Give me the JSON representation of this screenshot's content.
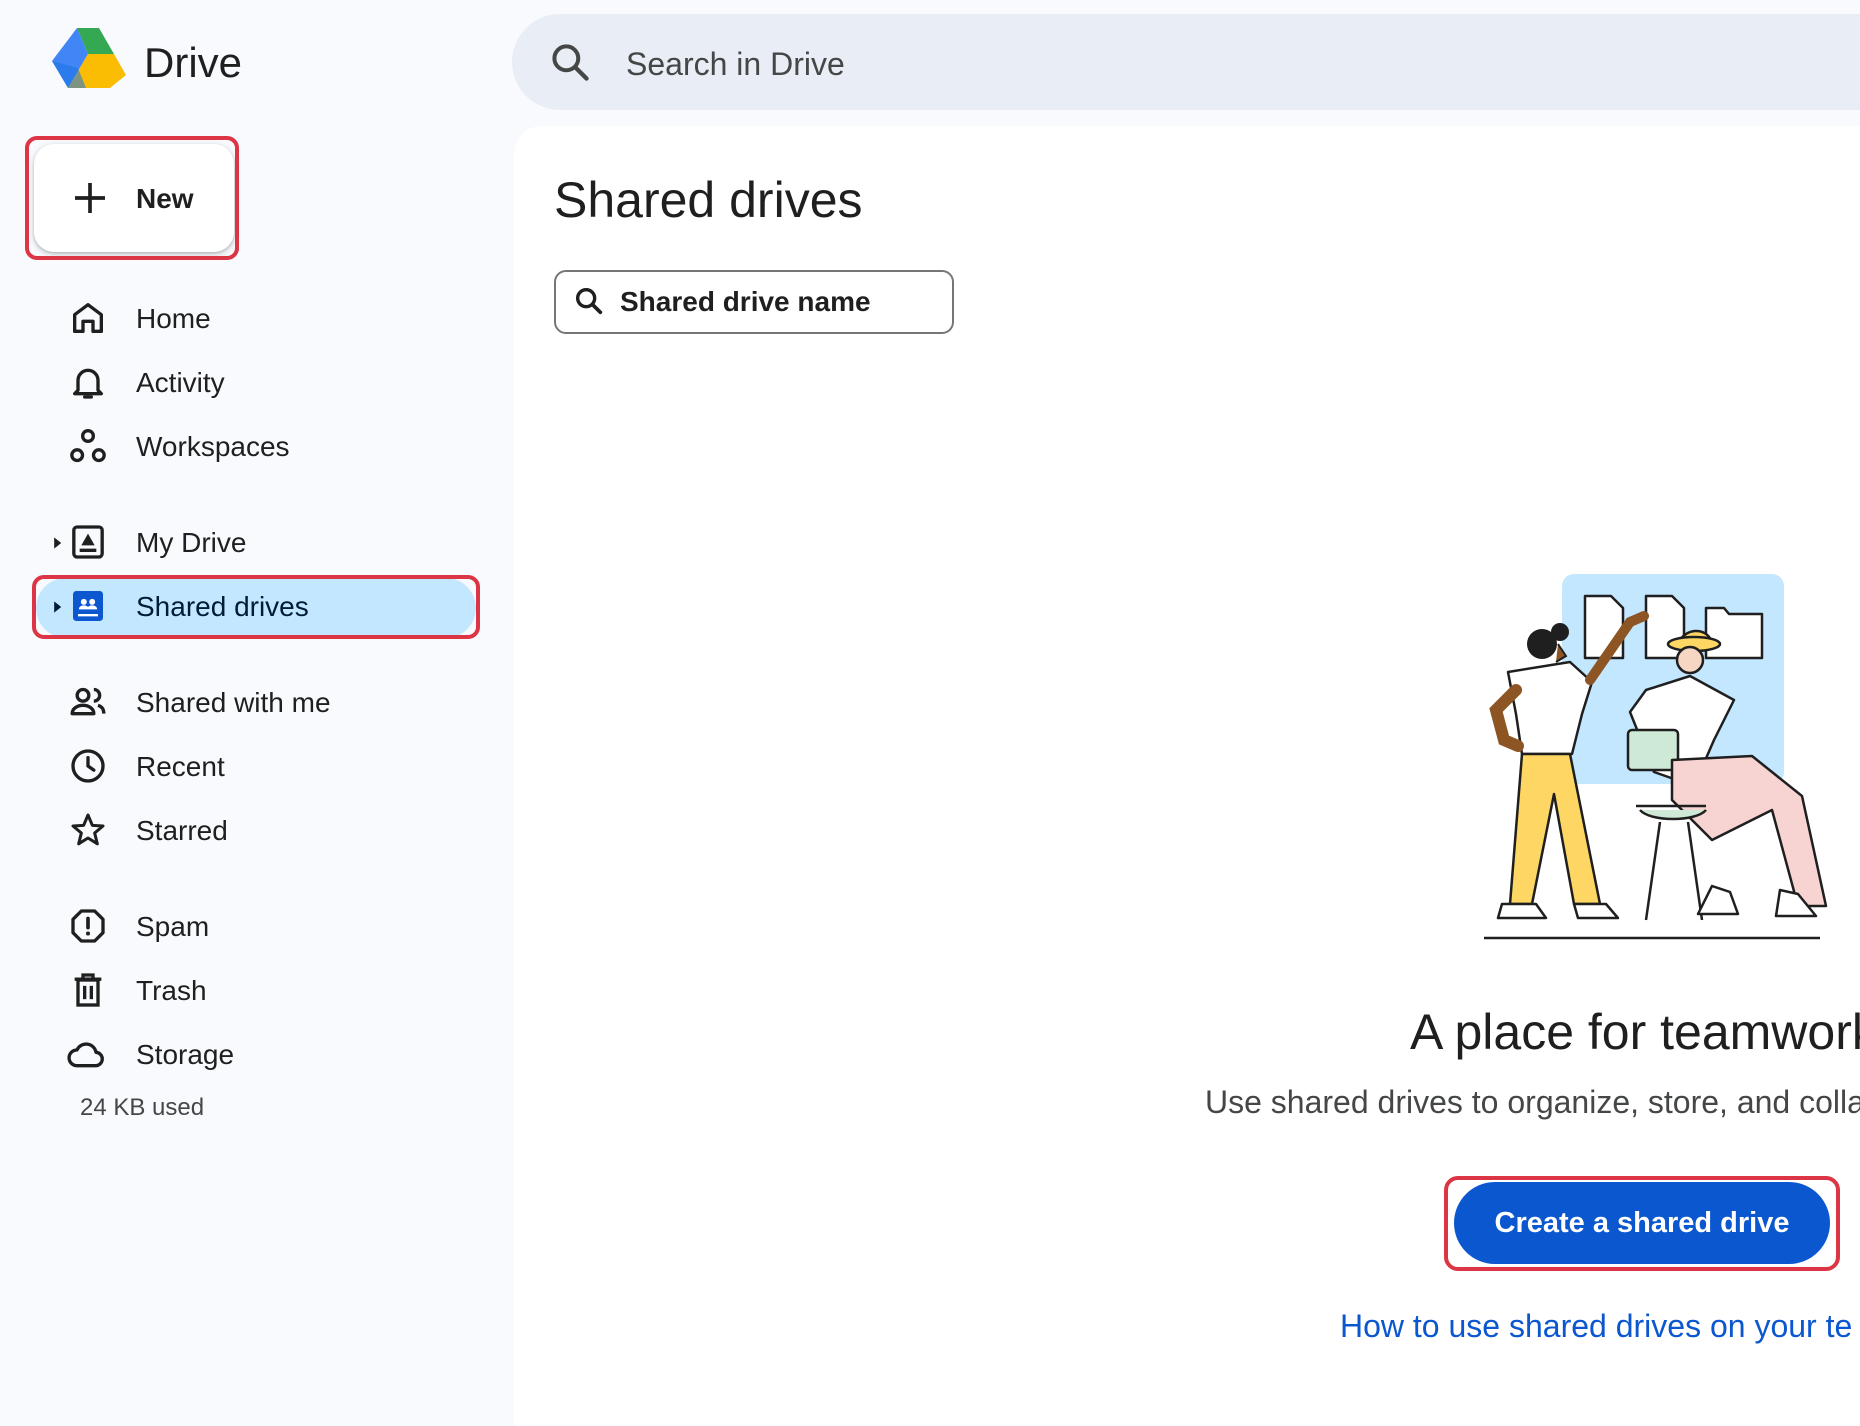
{
  "app": {
    "title": "Drive"
  },
  "search": {
    "placeholder": "Search in Drive"
  },
  "sidebar": {
    "new_label": "New",
    "items": [
      {
        "label": "Home",
        "icon": "home-icon"
      },
      {
        "label": "Activity",
        "icon": "bell-icon"
      },
      {
        "label": "Workspaces",
        "icon": "workspaces-icon"
      },
      {
        "label": "My Drive",
        "icon": "my-drive-icon"
      },
      {
        "label": "Shared drives",
        "icon": "shared-drives-icon",
        "active": true
      },
      {
        "label": "Shared with me",
        "icon": "people-icon"
      },
      {
        "label": "Recent",
        "icon": "clock-icon"
      },
      {
        "label": "Starred",
        "icon": "star-icon"
      },
      {
        "label": "Spam",
        "icon": "spam-icon"
      },
      {
        "label": "Trash",
        "icon": "trash-icon"
      },
      {
        "label": "Storage",
        "icon": "cloud-icon"
      }
    ],
    "storage_used": "24 KB used"
  },
  "main": {
    "title": "Shared drives",
    "filter_placeholder": "Shared drive name",
    "empty_title": "A place for teamwork",
    "empty_description": "Use shared drives to organize, store, and colla",
    "create_button": "Create a shared drive",
    "help_link": "How to use shared drives on your te"
  },
  "colors": {
    "accent": "#0b57d0",
    "active_bg": "#c2e7ff",
    "highlight": "#dc3545",
    "background": "#f8fafd"
  }
}
